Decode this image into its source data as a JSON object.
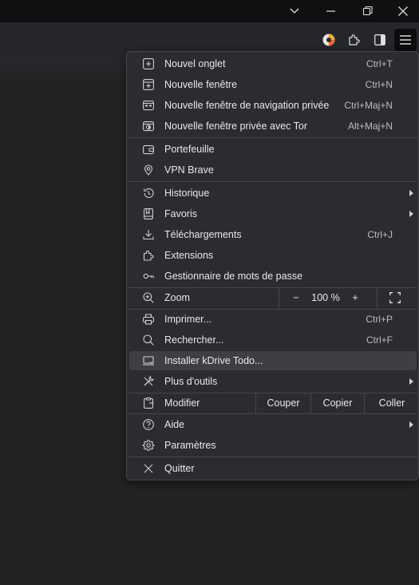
{
  "window": {
    "controls": [
      {
        "name": "tab-search",
        "icon": "chevron-down-icon"
      },
      {
        "name": "minimize",
        "icon": "minimize-icon"
      },
      {
        "name": "restore",
        "icon": "restore-icon"
      },
      {
        "name": "close",
        "icon": "close-icon"
      }
    ]
  },
  "toolbar": {
    "icons": [
      "brave-rewards-icon",
      "extensions-puzzle-icon",
      "sidebar-toggle-icon",
      "hamburger-menu-icon"
    ]
  },
  "menu": {
    "new_tab": {
      "label": "Nouvel onglet",
      "shortcut": "Ctrl+T"
    },
    "new_window": {
      "label": "Nouvelle fenêtre",
      "shortcut": "Ctrl+N"
    },
    "new_private": {
      "label": "Nouvelle fenêtre de navigation privée",
      "shortcut": "Ctrl+Maj+N"
    },
    "new_tor": {
      "label": "Nouvelle fenêtre privée avec Tor",
      "shortcut": "Alt+Maj+N"
    },
    "wallet": {
      "label": "Portefeuille"
    },
    "vpn": {
      "label": "VPN Brave"
    },
    "history": {
      "label": "Historique"
    },
    "bookmarks": {
      "label": "Favoris"
    },
    "downloads": {
      "label": "Téléchargements",
      "shortcut": "Ctrl+J"
    },
    "extensions": {
      "label": "Extensions"
    },
    "passwords": {
      "label": "Gestionnaire de mots de passe"
    },
    "zoom": {
      "label": "Zoom",
      "minus": "−",
      "value": "100 %",
      "plus": "+"
    },
    "print": {
      "label": "Imprimer...",
      "shortcut": "Ctrl+P"
    },
    "find": {
      "label": "Rechercher...",
      "shortcut": "Ctrl+F"
    },
    "install": {
      "label": "Installer kDrive Todo..."
    },
    "more_tools": {
      "label": "Plus d'outils"
    },
    "edit": {
      "label": "Modifier",
      "cut": "Couper",
      "copy": "Copier",
      "paste": "Coller"
    },
    "help": {
      "label": "Aide"
    },
    "settings": {
      "label": "Paramètres"
    },
    "quit": {
      "label": "Quitter"
    }
  },
  "colors": {
    "menu_bg": "#2b2c30",
    "highlight": "#3e3f43",
    "titlebar": "#0f1012",
    "toolbar": "#25272d",
    "page_bg": "#232323"
  }
}
